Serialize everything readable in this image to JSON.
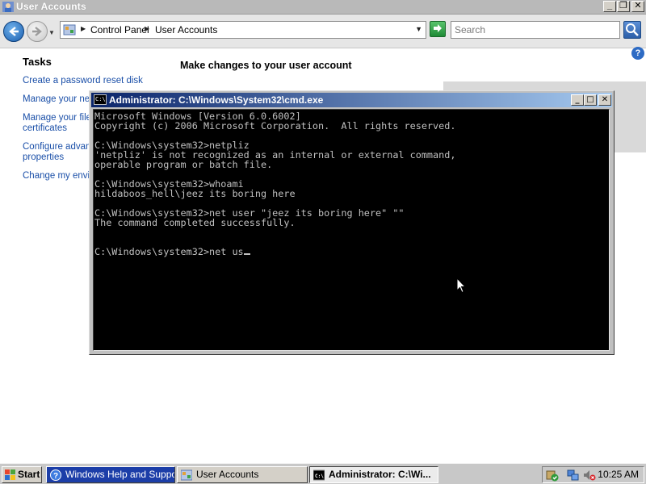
{
  "window": {
    "title": "User Accounts",
    "minimize": "_",
    "maximize": "❐",
    "close": "✕"
  },
  "address_bar": {
    "crumbs": [
      "Control Panel",
      "User Accounts"
    ],
    "search_placeholder": "Search"
  },
  "help_label": "?",
  "sidebar": {
    "title": "Tasks",
    "items": [
      {
        "label": "Create a password reset disk"
      },
      {
        "label": "Manage your network passwords"
      },
      {
        "label": "Manage your file encryption"
      },
      {
        "label": "certificates"
      },
      {
        "label": "Configure advanced user profile"
      },
      {
        "label": "properties"
      },
      {
        "label": "Change my environment variables"
      }
    ]
  },
  "main": {
    "heading": "Make changes to your user account"
  },
  "cmd": {
    "icon_text": "C:\\",
    "title": "Administrator: C:\\Windows\\System32\\cmd.exe",
    "minimize": "_",
    "maximize": "□",
    "close": "✕",
    "lines": [
      "Microsoft Windows [Version 6.0.6002]",
      "Copyright (c) 2006 Microsoft Corporation.  All rights reserved.",
      "",
      "C:\\Windows\\system32>netpliz",
      "'netpliz' is not recognized as an internal or external command,",
      "operable program or batch file.",
      "",
      "C:\\Windows\\system32>whoami",
      "hildaboos_hell\\jeez its boring here",
      "",
      "C:\\Windows\\system32>net user \"jeez its boring here\" \"\"",
      "The command completed successfully.",
      "",
      "",
      "C:\\Windows\\system32>net us"
    ]
  },
  "taskbar": {
    "start_label": "Start",
    "tasks": [
      {
        "label": "Windows Help and Support",
        "active": false
      },
      {
        "label": "User Accounts",
        "active": false
      },
      {
        "label": "Administrator: C:\\Wi...",
        "active": true
      }
    ],
    "clock": "10:25 AM"
  },
  "colors": {
    "cmd_title_gradient_start": "#0a246a",
    "cmd_title_gradient_end": "#a6caf0",
    "link": "#1a4fa8",
    "help_task_button": "#1c3ea8"
  },
  "icons": {
    "back": "back-arrow-icon",
    "forward": "forward-arrow-icon",
    "refresh": "refresh-icon",
    "search": "search-icon",
    "help": "help-icon",
    "cmd": "cmd-icon",
    "start": "windows-flag-icon"
  }
}
